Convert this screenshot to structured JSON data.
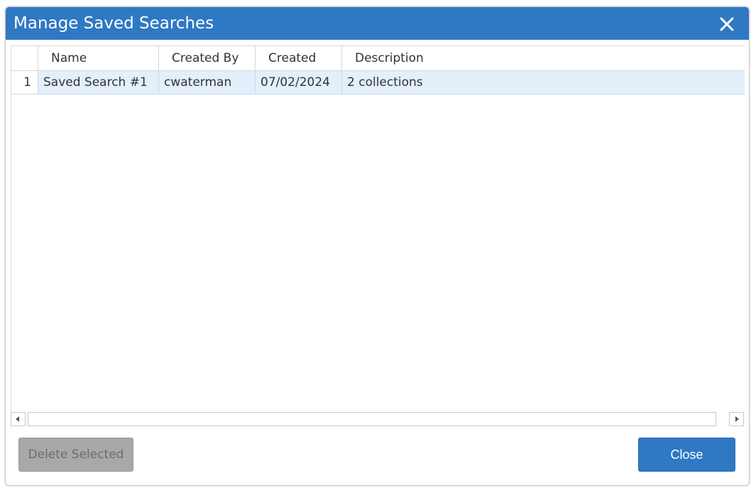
{
  "dialog": {
    "title": "Manage Saved Searches",
    "close_icon": "close-icon"
  },
  "table": {
    "columns": [
      "Name",
      "Created By",
      "Created",
      "Description"
    ],
    "rows": [
      {
        "num": "1",
        "name": "Saved Search #1",
        "created_by": "cwaterman",
        "created": "07/02/2024",
        "description": "2 collections"
      }
    ]
  },
  "footer": {
    "delete_label": "Delete Selected",
    "close_label": "Close"
  },
  "colors": {
    "accent": "#2f78c4",
    "selected_row": "#e3effb",
    "disabled_button": "#a8a8a8"
  }
}
